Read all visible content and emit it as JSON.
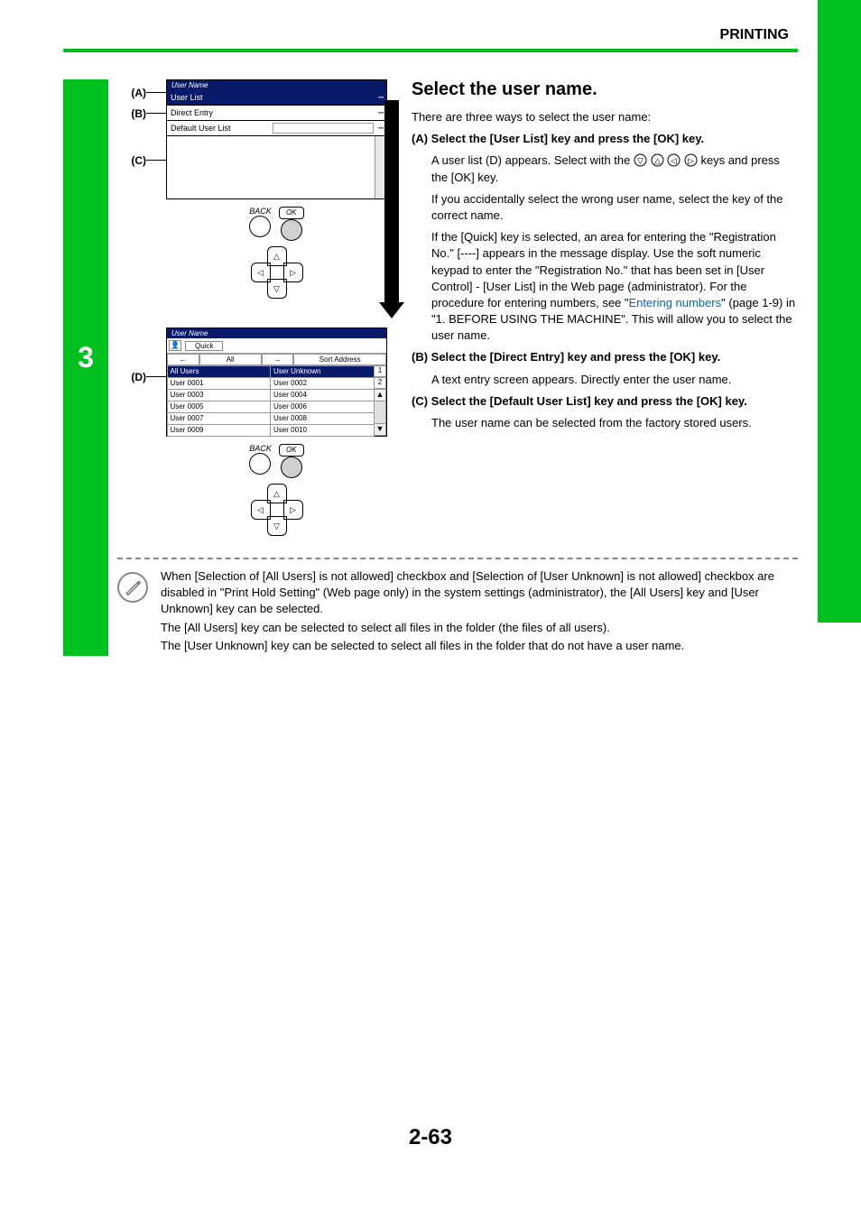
{
  "header": {
    "section": "PRINTING"
  },
  "step": {
    "number": "3"
  },
  "callouts": {
    "a": "(A)",
    "b": "(B)",
    "c": "(C)",
    "d": "(D)"
  },
  "panel1": {
    "title": "User Name",
    "r1": "User List",
    "r2": "Direct Entry",
    "r3": "Default User List"
  },
  "pad": {
    "back": "BACK",
    "ok": "OK"
  },
  "panel2": {
    "title": "User Name",
    "quick": "Quick",
    "tab_all": "All",
    "sort": "Sort Address",
    "h1": "All Users",
    "h2": "User Unknown",
    "n1": "1",
    "n2": "2",
    "rows": [
      [
        "User 0001",
        "User 0002"
      ],
      [
        "User 0003",
        "User 0004"
      ],
      [
        "User 0005",
        "User 0006"
      ],
      [
        "User 0007",
        "User 0008"
      ],
      [
        "User 0009",
        "User 0010"
      ]
    ]
  },
  "text": {
    "heading": "Select the user name.",
    "intro": "There are three ways to select the user name:",
    "a_label": "(A) Select the [User List] key and press the [OK] key.",
    "a_p1a": "A user list (D) appears. Select with the ",
    "a_p1b": " keys and press the [OK] key.",
    "a_p2": "If you accidentally select the wrong user name, select the key of the correct name.",
    "a_p3a": "If the [Quick] key is selected, an area for entering the \"Registration No.\" [----] appears in the message display. Use the soft numeric keypad to enter the \"Registration No.\" that has been set in [User Control] - [User List] in the Web page (administrator). For the procedure for entering numbers, see \"",
    "a_link": "Entering numbers",
    "a_p3b": "\" (page 1-9) in \"1. BEFORE USING THE MACHINE\". This will allow you to select the user name.",
    "b_label": "(B) Select the [Direct Entry] key and press the [OK] key.",
    "b_p1": "A text entry screen appears. Directly enter the user name.",
    "c_label": "(C) Select the [Default User List] key and press the [OK] key.",
    "c_p1": "The user name can be selected from the factory stored users."
  },
  "note": {
    "p1": "When [Selection of [All Users] is not allowed] checkbox and [Selection of [User Unknown] is not allowed] checkbox are disabled in \"Print Hold Setting\" (Web page only) in the system settings (administrator), the [All Users] key and [User Unknown] key can be selected.",
    "p2": "The [All Users] key can be selected to select all files in the folder (the files of all users).",
    "p3": "The [User Unknown] key can be selected to select all files in the folder that do not have a user name."
  },
  "page_number": "2-63"
}
